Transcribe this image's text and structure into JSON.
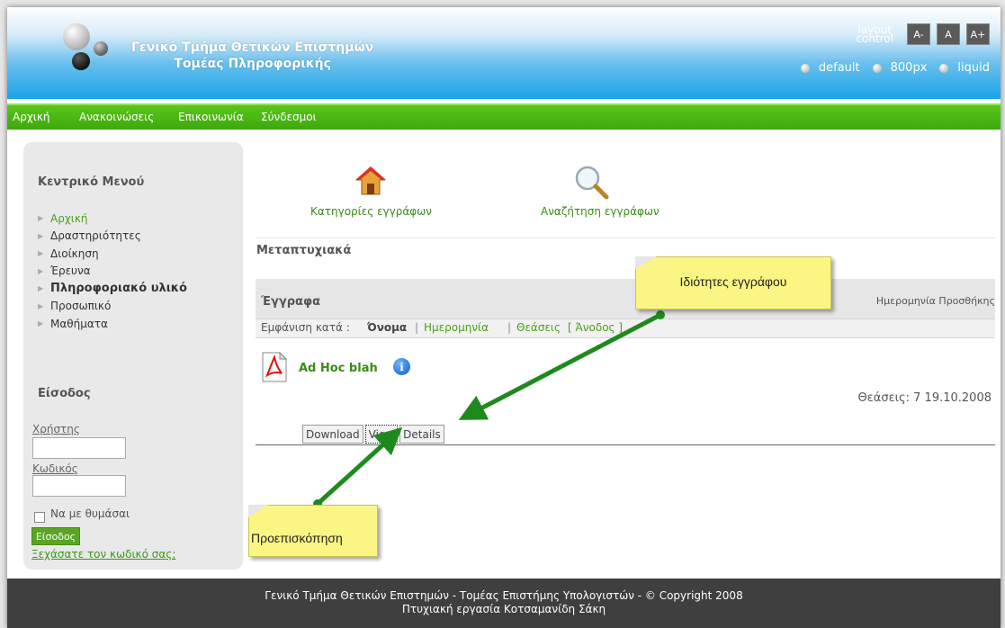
{
  "header": {
    "title_line1": "Γενικό Τμήμα Θετικών Επιστημών",
    "title_line2": "Τομέας Πληροφορικής",
    "layout_control_line1": "layout",
    "layout_control_line2": "control",
    "font_buttons": [
      "A-",
      "A",
      "A+"
    ],
    "width_options": [
      "default",
      "800px",
      "liquid"
    ]
  },
  "nav": {
    "items": [
      "Αρχική",
      "Ανακοινώσεις",
      "Επικοινωνία",
      "Σύνδεσμοι"
    ]
  },
  "sidebar": {
    "title": "Κεντρικό Μενού",
    "menu": [
      {
        "label": "Αρχική",
        "active": true,
        "bold": false
      },
      {
        "label": "Δραστηριότητες",
        "active": false,
        "bold": false
      },
      {
        "label": "Διοίκηση",
        "active": false,
        "bold": false
      },
      {
        "label": "Έρευνα",
        "active": false,
        "bold": false
      },
      {
        "label": "Πληροφοριακό υλικό",
        "active": false,
        "bold": true
      },
      {
        "label": "Προσωπικό",
        "active": false,
        "bold": false
      },
      {
        "label": "Μαθήματα",
        "active": false,
        "bold": false
      }
    ],
    "login": {
      "title": "Είσοδος",
      "username_label": "Χρήστης",
      "username_value": "",
      "password_label": "Κωδικός",
      "password_value": "",
      "remember_label": "Να με θυμάσαι",
      "submit_label": "Είσοδος",
      "forgot_label": "Ξεχάσατε τον κωδικό σας;"
    }
  },
  "main": {
    "categories_label": "Κατηγορίες εγγράφων",
    "search_label": "Αναζήτηση εγγράφων",
    "section_title": "Μεταπτυχιακά",
    "documents_title": "Έγγραφα",
    "date_column": "Ημερομηνία Προσθήκης",
    "sort_label": "Εμφάνιση κατά :",
    "sort_name": "Όνομα",
    "sort_date": "Ημερομηνία",
    "sort_views": "Θεάσεις",
    "sort_order": "[ Άνοδος ]",
    "document": {
      "name": "Ad Hoc blah",
      "views": "Θεάσεις: 7 19.10.2008",
      "buttons": [
        "Download",
        "View",
        "Details"
      ]
    }
  },
  "callouts": {
    "properties": "Ιδιότητες εγγράφου",
    "preview": "Προεπισκόπηση"
  },
  "footer": {
    "line1": "Γενικό Τμήμα Θετικών Επιστημών - Τομέας Επιστήμης Υπολογιστών - © Copyright 2008",
    "line2": "Πτυχιακή εργασία Κοτσαμανίδη Σάκη"
  },
  "colors": {
    "header_blue": "#1aa4e6",
    "nav_green": "#4ab714",
    "link_green": "#4aa019",
    "arrow_green": "#1e8a1e",
    "callout_yellow": "#fbf584",
    "footer_dark": "#3f3f3f"
  }
}
